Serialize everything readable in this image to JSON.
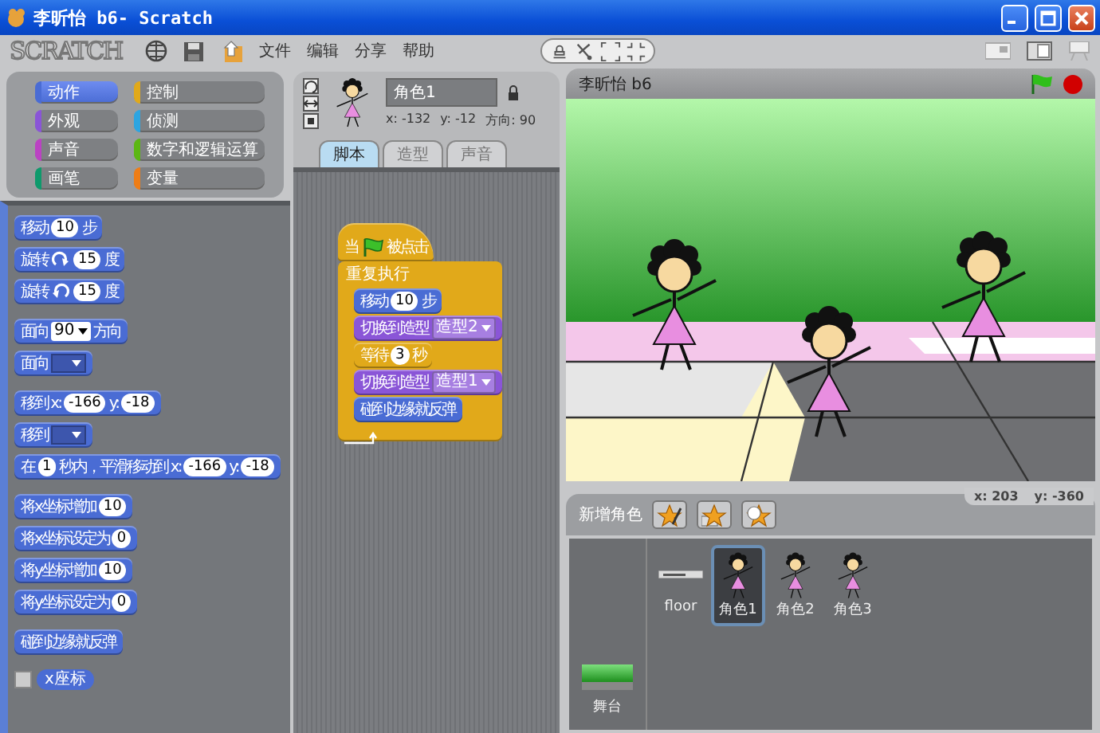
{
  "window": {
    "title": "李昕怡 b6- Scratch"
  },
  "menu": {
    "logo": "SCRATCH",
    "items": [
      "文件",
      "编辑",
      "分享",
      "帮助"
    ]
  },
  "categories": [
    {
      "label": "动作",
      "color": "#4a6cd4",
      "selected": true
    },
    {
      "label": "控制",
      "color": "#e1a91a",
      "selected": false
    },
    {
      "label": "外观",
      "color": "#8a55d7",
      "selected": false
    },
    {
      "label": "侦测",
      "color": "#2ca5e2",
      "selected": false
    },
    {
      "label": "声音",
      "color": "#bb42c3",
      "selected": false
    },
    {
      "label": "数字和逻辑运算",
      "color": "#5cb712",
      "selected": false
    },
    {
      "label": "画笔",
      "color": "#0e9a6c",
      "selected": false
    },
    {
      "label": "变量",
      "color": "#ee7d16",
      "selected": false
    }
  ],
  "palette": {
    "groups": [
      [
        {
          "kind": "motion",
          "parts": [
            {
              "kind": "text",
              "text": "移动"
            },
            {
              "kind": "num",
              "text": "10"
            },
            {
              "kind": "text",
              "text": "步"
            }
          ]
        },
        {
          "kind": "motion",
          "parts": [
            {
              "kind": "text",
              "text": "旋转"
            },
            {
              "kind": "turn_right"
            },
            {
              "kind": "num",
              "text": "15"
            },
            {
              "kind": "text",
              "text": "度"
            }
          ]
        },
        {
          "kind": "motion",
          "parts": [
            {
              "kind": "text",
              "text": "旋转"
            },
            {
              "kind": "turn_left"
            },
            {
              "kind": "num",
              "text": "15"
            },
            {
              "kind": "text",
              "text": "度"
            }
          ]
        }
      ],
      [
        {
          "kind": "motion",
          "parts": [
            {
              "kind": "text",
              "text": "面向"
            },
            {
              "kind": "dropdown",
              "text": "90"
            },
            {
              "kind": "text",
              "text": "方向"
            }
          ]
        },
        {
          "kind": "motion",
          "parts": [
            {
              "kind": "text",
              "text": "面向"
            },
            {
              "kind": "slot"
            }
          ]
        }
      ],
      [
        {
          "kind": "motion",
          "parts": [
            {
              "kind": "text",
              "text": "移到 x:"
            },
            {
              "kind": "num",
              "text": "-166"
            },
            {
              "kind": "text",
              "text": "y:"
            },
            {
              "kind": "num",
              "text": "-18"
            }
          ]
        },
        {
          "kind": "motion",
          "parts": [
            {
              "kind": "text",
              "text": "移到"
            },
            {
              "kind": "slot"
            }
          ]
        },
        {
          "kind": "motion",
          "parts": [
            {
              "kind": "text",
              "text": "在"
            },
            {
              "kind": "num",
              "text": "1"
            },
            {
              "kind": "text",
              "text": "秒内，平滑移动到 x:"
            },
            {
              "kind": "num",
              "text": "-166"
            },
            {
              "kind": "text",
              "text": "y:"
            },
            {
              "kind": "num",
              "text": "-18"
            }
          ]
        }
      ],
      [
        {
          "kind": "motion",
          "parts": [
            {
              "kind": "text",
              "text": "将x坐标增加"
            },
            {
              "kind": "num",
              "text": "10"
            }
          ]
        },
        {
          "kind": "motion",
          "parts": [
            {
              "kind": "text",
              "text": "将x坐标设定为"
            },
            {
              "kind": "num",
              "text": "0"
            }
          ]
        },
        {
          "kind": "motion",
          "parts": [
            {
              "kind": "text",
              "text": "将y坐标增加"
            },
            {
              "kind": "num",
              "text": "10"
            }
          ]
        },
        {
          "kind": "motion",
          "parts": [
            {
              "kind": "text",
              "text": "将y坐标设定为"
            },
            {
              "kind": "num",
              "text": "0"
            }
          ]
        }
      ],
      [
        {
          "kind": "motion",
          "parts": [
            {
              "kind": "text",
              "text": "碰到边缘就反弹"
            }
          ]
        }
      ]
    ],
    "reporters": [
      {
        "label": "x座标",
        "checked": false
      }
    ]
  },
  "sprite_info": {
    "name": "角色1",
    "x": "x: -132",
    "y": "y: -12",
    "direction": "方向: 90"
  },
  "tabs": [
    {
      "label": "脚本",
      "selected": true
    },
    {
      "label": "造型",
      "selected": false
    },
    {
      "label": "声音",
      "selected": false
    }
  ],
  "script": {
    "hat": {
      "kind": "control",
      "parts": [
        {
          "kind": "text",
          "text": "当"
        },
        {
          "kind": "flag"
        },
        {
          "kind": "text",
          "text": "被点击"
        }
      ]
    },
    "loop": {
      "kind": "control",
      "parts": [
        {
          "kind": "text",
          "text": "重复执行"
        }
      ],
      "children": [
        {
          "kind": "motion",
          "parts": [
            {
              "kind": "text",
              "text": "移动"
            },
            {
              "kind": "num",
              "text": "10"
            },
            {
              "kind": "text",
              "text": "步"
            }
          ]
        },
        {
          "kind": "looks",
          "parts": [
            {
              "kind": "text",
              "text": "切换到造型"
            },
            {
              "kind": "dropdown",
              "text": "造型2"
            }
          ]
        },
        {
          "kind": "control",
          "parts": [
            {
              "kind": "text",
              "text": "等待"
            },
            {
              "kind": "num",
              "text": "3"
            },
            {
              "kind": "text",
              "text": "秒"
            }
          ]
        },
        {
          "kind": "looks",
          "parts": [
            {
              "kind": "text",
              "text": "切换到造型"
            },
            {
              "kind": "dropdown",
              "text": "造型1"
            }
          ]
        },
        {
          "kind": "motion",
          "parts": [
            {
              "kind": "text",
              "text": "碰到边缘就反弹"
            }
          ]
        }
      ]
    }
  },
  "stage": {
    "title": "李昕怡 b6"
  },
  "mouse": {
    "x": "x: 203",
    "y": "y: -360"
  },
  "sprites": {
    "heading": "新增角色",
    "items": [
      {
        "name": "floor",
        "kind": "floor",
        "selected": false
      },
      {
        "name": "角色1",
        "kind": "figure",
        "selected": true
      },
      {
        "name": "角色2",
        "kind": "figure",
        "selected": false
      },
      {
        "name": "角色3",
        "kind": "figure",
        "selected": false
      }
    ],
    "stage_label": "舞台"
  }
}
